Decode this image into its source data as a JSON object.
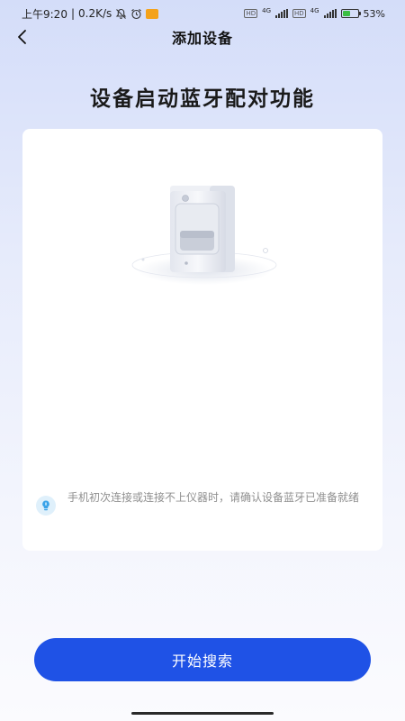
{
  "status_bar": {
    "time": "上午9:20",
    "separator": "|",
    "network_speed": "0.2K/s",
    "network_label_1": "4G",
    "network_label_2": "4G",
    "hd_label_1": "HD",
    "hd_label_2": "HD",
    "battery_percent": "53%",
    "battery_level": 0.53,
    "battery_color": "#3bbf43",
    "icons": [
      "mute-bell-icon",
      "alarm-icon",
      "app-notification-icon",
      "signal-icon",
      "battery-icon"
    ]
  },
  "nav": {
    "title": "添加设备",
    "back_icon": "chevron-left-icon"
  },
  "headline": "设备启动蓝牙配对功能",
  "card": {
    "illustration": "pet-feeder-device",
    "tip_icon": "lightbulb-icon",
    "tip_text": "手机初次连接或连接不上仪器时，请确认设备蓝牙已准备就绪"
  },
  "primary_action": {
    "label": "开始搜索",
    "color": "#1f52e6"
  }
}
